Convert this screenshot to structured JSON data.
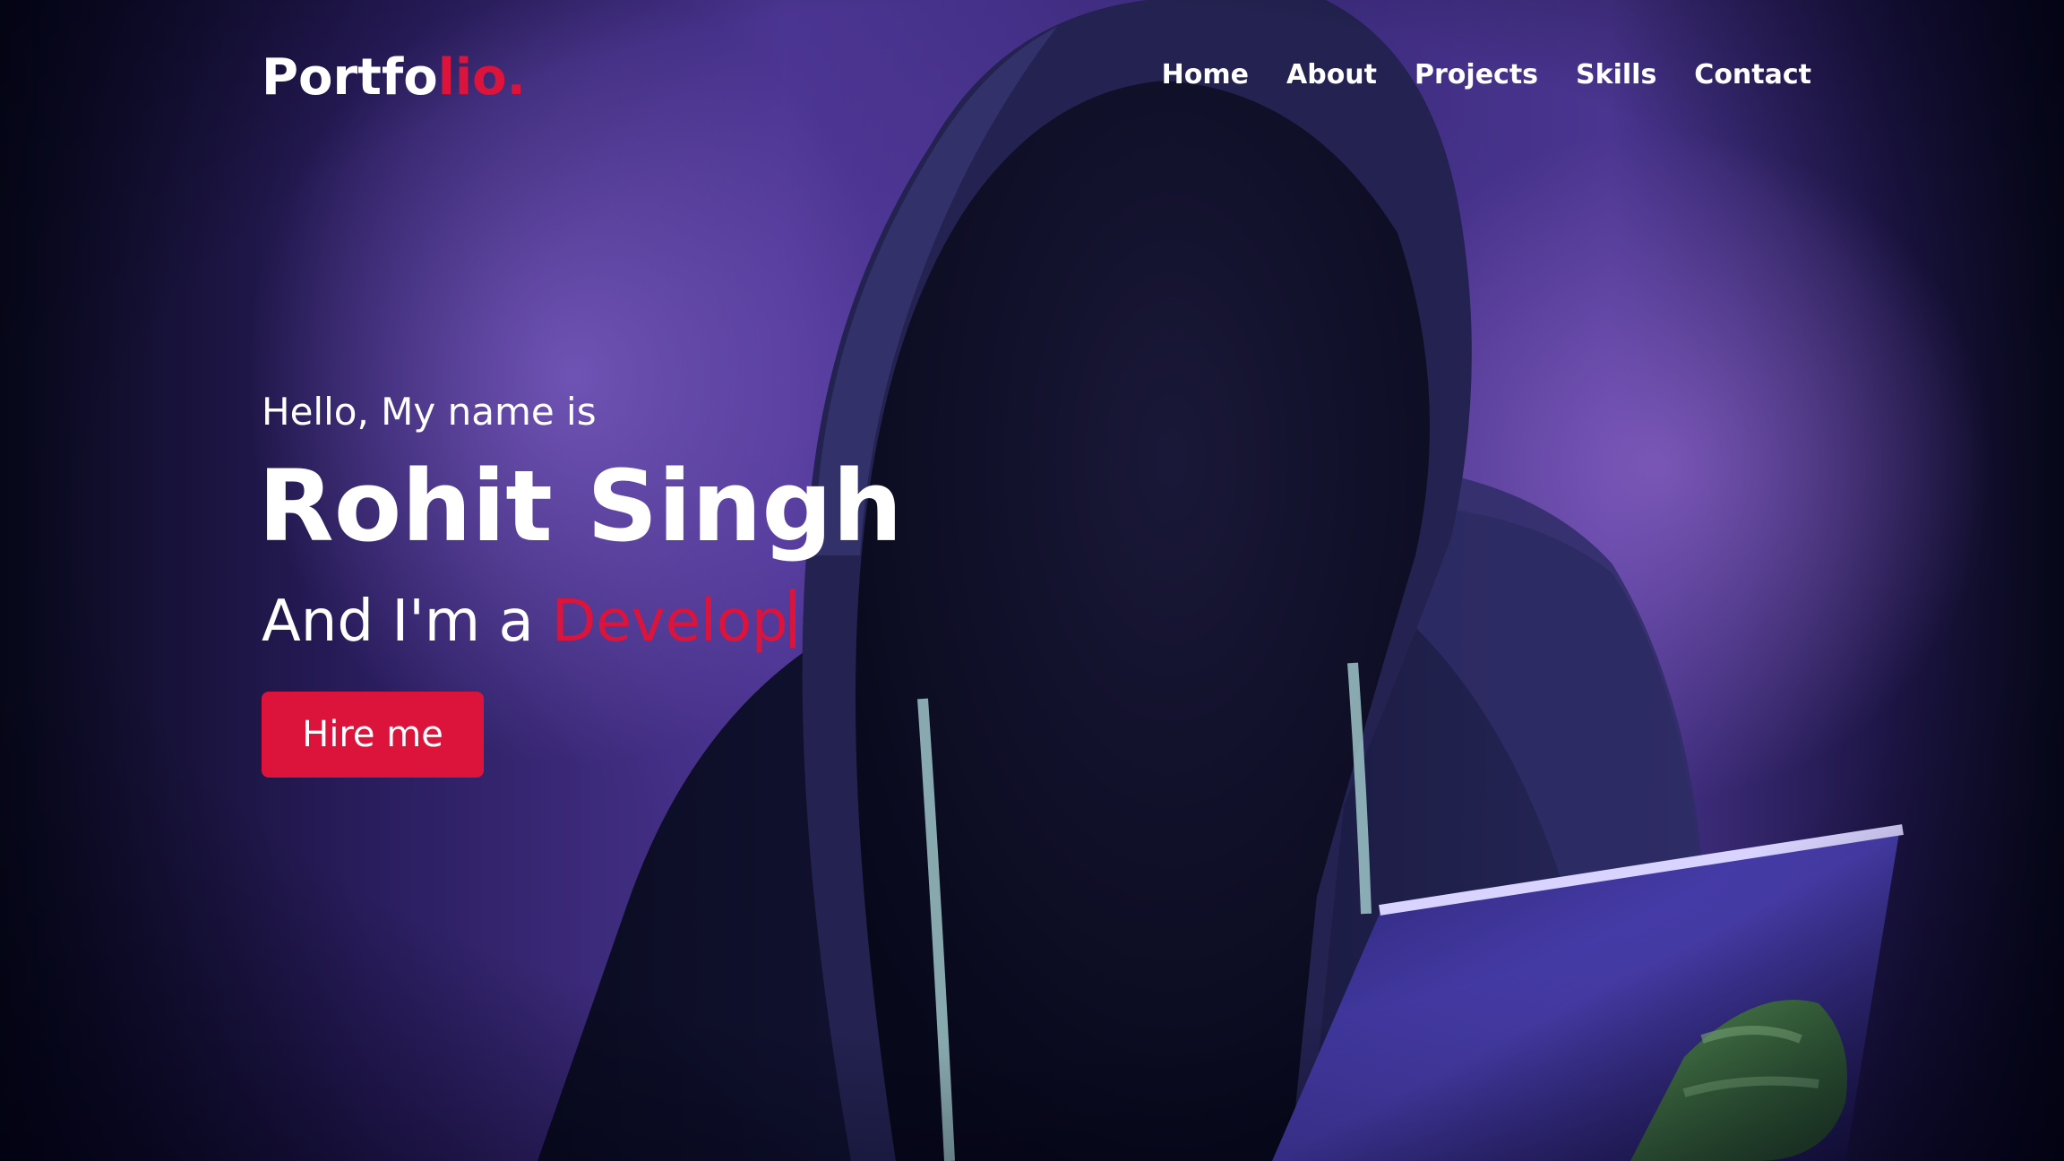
{
  "navbar": {
    "logo_main": "Portfo",
    "logo_accent": "lio.",
    "menu": [
      {
        "label": "Home"
      },
      {
        "label": "About"
      },
      {
        "label": "Projects"
      },
      {
        "label": "Skills"
      },
      {
        "label": "Contact"
      }
    ]
  },
  "hero": {
    "greeting": "Hello, My name is",
    "name": "Rohit Singh",
    "role_prefix": "And I'm a ",
    "role_typed": "Develop",
    "button_label": "Hire me"
  },
  "colors": {
    "accent": "#dc143c",
    "text": "#ffffff",
    "background_dark": "#0a0b1e",
    "background_purple": "#4b3592"
  },
  "icons": {
    "hero_image": "hooded-figure-with-tablet-illustration"
  }
}
